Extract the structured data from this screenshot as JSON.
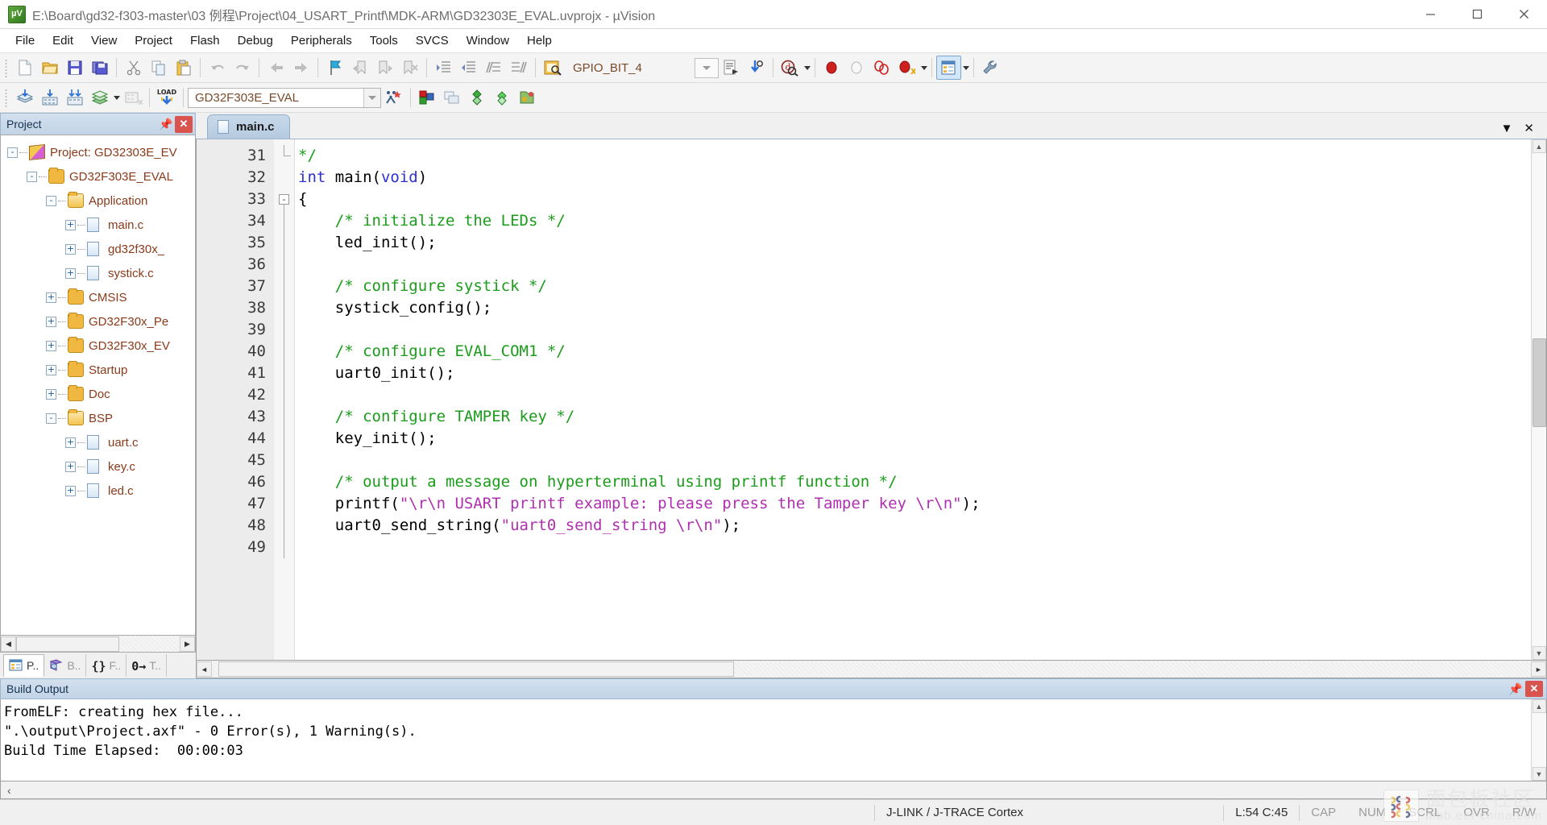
{
  "window": {
    "title": "E:\\Board\\gd32-f303-master\\03 例程\\Project\\04_USART_Printf\\MDK-ARM\\GD32303E_EVAL.uvprojx - µVision",
    "app_icon": "uvision-icon",
    "minimize_label": "—",
    "maximize_label": "▢",
    "close_label": "✕"
  },
  "menu": {
    "items": [
      "File",
      "Edit",
      "View",
      "Project",
      "Flash",
      "Debug",
      "Peripherals",
      "Tools",
      "SVCS",
      "Window",
      "Help"
    ]
  },
  "toolbar_main": {
    "groups": [
      [
        "new-file-icon",
        "open-file-icon",
        "save-icon",
        "save-all-icon"
      ],
      [
        "cut-icon",
        "copy-icon",
        "paste-icon"
      ],
      [
        "undo-icon",
        "redo-icon"
      ],
      [
        "navigate-back-icon",
        "navigate-forward-icon"
      ],
      [
        "bookmark-toggle-icon",
        "bookmark-prev-icon",
        "bookmark-next-icon",
        "bookmark-clear-icon"
      ],
      [
        "indent-icon",
        "outdent-icon",
        "comment-icon",
        "uncomment-icon"
      ],
      [
        "find-in-files-icon"
      ]
    ],
    "symbol_value": "GPIO_BIT_4",
    "after_combo": [
      "browse-symbol-icon",
      "find-icon"
    ],
    "debug_group": [
      "start-debug-icon"
    ],
    "breakpoint_group": [
      "insert-breakpoint-icon",
      "disable-breakpoint-icon",
      "kill-all-breakpoints-icon",
      "disable-all-breakpoints-icon"
    ],
    "window_group": [
      "project-window-icon"
    ],
    "config_group": [
      "configure-icon"
    ]
  },
  "toolbar_build": {
    "buttons": [
      "translate-icon",
      "build-icon",
      "rebuild-icon",
      "batch-build-icon",
      "stop-build-icon",
      "download-icon"
    ],
    "target_value": "GD32F303E_EVAL",
    "after": [
      "target-options-icon",
      "manage-run-time-icon",
      "pack-installer-icon",
      "manage-multi-icon",
      "svcs-icon",
      "books-icon"
    ]
  },
  "project_panel": {
    "title": "Project",
    "pin_icon": "pin-icon",
    "close_icon": "close-icon",
    "tree": [
      {
        "level": 0,
        "toggle": "-",
        "icon": "project-icon",
        "label": "Project: GD32303E_EV"
      },
      {
        "level": 1,
        "toggle": "-",
        "icon": "target-folder-icon",
        "label": "GD32F303E_EVAL"
      },
      {
        "level": 2,
        "toggle": "-",
        "icon": "folder-open-icon",
        "label": "Application"
      },
      {
        "level": 3,
        "toggle": "+",
        "icon": "c-file-icon",
        "label": "main.c"
      },
      {
        "level": 3,
        "toggle": "+",
        "icon": "c-file-icon",
        "label": "gd32f30x_"
      },
      {
        "level": 3,
        "toggle": "+",
        "icon": "c-file-icon",
        "label": "systick.c"
      },
      {
        "level": 2,
        "toggle": "+",
        "icon": "folder-icon",
        "label": "CMSIS"
      },
      {
        "level": 2,
        "toggle": "+",
        "icon": "folder-icon",
        "label": "GD32F30x_Pe"
      },
      {
        "level": 2,
        "toggle": "+",
        "icon": "folder-icon",
        "label": "GD32F30x_EV"
      },
      {
        "level": 2,
        "toggle": "+",
        "icon": "folder-icon",
        "label": "Startup"
      },
      {
        "level": 2,
        "toggle": "+",
        "icon": "folder-icon",
        "label": "Doc"
      },
      {
        "level": 2,
        "toggle": "-",
        "icon": "folder-open-icon",
        "label": "BSP"
      },
      {
        "level": 3,
        "toggle": "+",
        "icon": "c-file-icon",
        "label": "uart.c"
      },
      {
        "level": 3,
        "toggle": "+",
        "icon": "c-file-icon",
        "label": "key.c"
      },
      {
        "level": 3,
        "toggle": "+",
        "icon": "c-file-icon",
        "label": "led.c"
      }
    ],
    "tabs": [
      {
        "label": "P..",
        "icon": "project-tab-icon",
        "active": true
      },
      {
        "label": "B..",
        "icon": "books-tab-icon",
        "active": false
      },
      {
        "label": "F..",
        "icon": "functions-tab-icon",
        "active": false
      },
      {
        "label": "T..",
        "icon": "templates-tab-icon",
        "active": false
      }
    ],
    "scroll_left_icon": "◀",
    "scroll_right_icon": "▶"
  },
  "editor": {
    "tabs": [
      {
        "label": "main.c",
        "icon": "c-file-icon",
        "active": true
      }
    ],
    "tab_menu_icon": "chevron-down-icon",
    "tab_close_icon": "close-icon",
    "first_line_number": 31,
    "lines": [
      {
        "n": 31,
        "fold": "end",
        "tokens": [
          {
            "t": "*/",
            "c": "cmt"
          }
        ]
      },
      {
        "n": 32,
        "fold": "",
        "tokens": [
          {
            "t": "int",
            "c": "kw"
          },
          {
            "t": " main(",
            "c": "pun"
          },
          {
            "t": "void",
            "c": "kw"
          },
          {
            "t": ")",
            "c": "pun"
          }
        ]
      },
      {
        "n": 33,
        "fold": "box",
        "tokens": [
          {
            "t": "{",
            "c": "pun"
          }
        ]
      },
      {
        "n": 34,
        "fold": "line",
        "tokens": [
          {
            "t": "    /* initialize the LEDs */",
            "c": "cmt"
          }
        ]
      },
      {
        "n": 35,
        "fold": "line",
        "tokens": [
          {
            "t": "    led_init();",
            "c": "pun"
          }
        ]
      },
      {
        "n": 36,
        "fold": "line",
        "tokens": [
          {
            "t": "",
            "c": "pun"
          }
        ]
      },
      {
        "n": 37,
        "fold": "line",
        "tokens": [
          {
            "t": "    /* configure systick */",
            "c": "cmt"
          }
        ]
      },
      {
        "n": 38,
        "fold": "line",
        "tokens": [
          {
            "t": "    systick_config();",
            "c": "pun"
          }
        ]
      },
      {
        "n": 39,
        "fold": "line",
        "tokens": [
          {
            "t": "",
            "c": "pun"
          }
        ]
      },
      {
        "n": 40,
        "fold": "line",
        "tokens": [
          {
            "t": "    /* configure EVAL_COM1 */",
            "c": "cmt"
          }
        ]
      },
      {
        "n": 41,
        "fold": "line",
        "tokens": [
          {
            "t": "    uart0_init();",
            "c": "pun"
          }
        ]
      },
      {
        "n": 42,
        "fold": "line",
        "tokens": [
          {
            "t": "",
            "c": "pun"
          }
        ]
      },
      {
        "n": 43,
        "fold": "line",
        "tokens": [
          {
            "t": "    /* configure TAMPER key */",
            "c": "cmt"
          }
        ]
      },
      {
        "n": 44,
        "fold": "line",
        "tokens": [
          {
            "t": "    key_init();",
            "c": "pun"
          }
        ]
      },
      {
        "n": 45,
        "fold": "line",
        "tokens": [
          {
            "t": "",
            "c": "pun"
          }
        ]
      },
      {
        "n": 46,
        "fold": "line",
        "tokens": [
          {
            "t": "    /* output a message on hyperterminal using printf function */",
            "c": "cmt"
          }
        ]
      },
      {
        "n": 47,
        "fold": "line",
        "tokens": [
          {
            "t": "    printf(",
            "c": "pun"
          },
          {
            "t": "\"\\r\\n USART printf example: please press the Tamper key \\r\\n\"",
            "c": "str"
          },
          {
            "t": ");",
            "c": "pun"
          }
        ]
      },
      {
        "n": 48,
        "fold": "line",
        "tokens": [
          {
            "t": "    uart0_send_string(",
            "c": "pun"
          },
          {
            "t": "\"uart0_send_string \\r\\n\"",
            "c": "str"
          },
          {
            "t": ");",
            "c": "pun"
          }
        ]
      },
      {
        "n": 49,
        "fold": "line",
        "tokens": [
          {
            "t": "",
            "c": "pun"
          }
        ]
      }
    ]
  },
  "build_output": {
    "title": "Build Output",
    "pin_icon": "pin-icon",
    "close_icon": "close-icon",
    "lines": [
      "FromELF: creating hex file...",
      "\".\\output\\Project.axf\" - 0 Error(s), 1 Warning(s).",
      "Build Time Elapsed:  00:00:03"
    ],
    "scroll_left_icon": "‹"
  },
  "status_bar": {
    "debugger": "J-LINK / J-TRACE Cortex",
    "cursor": "L:54 C:45",
    "cap": "CAP",
    "num": "NUM",
    "scrl": "SCRL",
    "ovr": "OVR",
    "rw": "R/W"
  },
  "watermark": {
    "cn": "面包板社区",
    "en": "mbb.eet-china.com"
  },
  "colors": {
    "accent": "#c2d4e6",
    "panel_border": "#9fb6cc",
    "comment": "#1a9c1a",
    "keyword": "#2f2fd8",
    "string": "#b02fb0",
    "tree_text": "#8a3a1a",
    "close_red": "#d9534f"
  }
}
